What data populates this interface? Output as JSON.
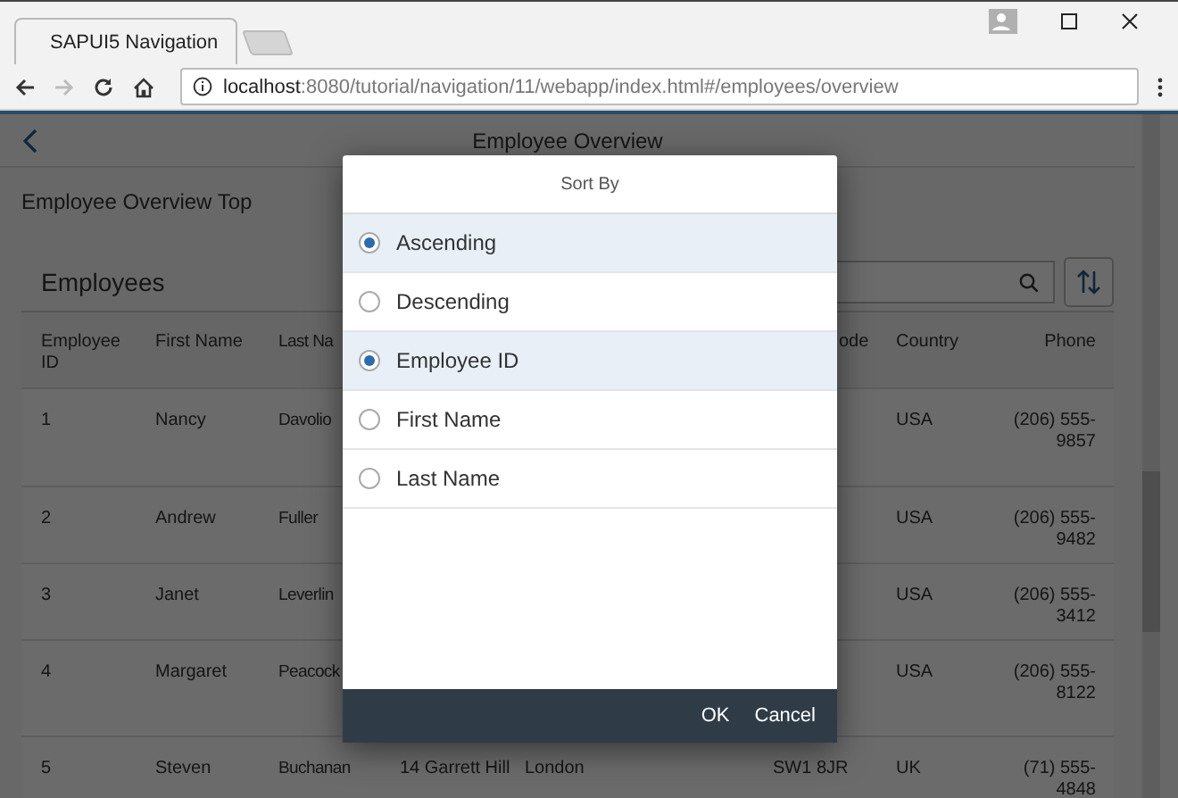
{
  "browser": {
    "tab_title": "SAPUI5 Navigation",
    "url_host": "localhost",
    "url_rest": ":8080/tutorial/navigation/11/webapp/index.html#/employees/overview"
  },
  "page": {
    "title": "Employee Overview",
    "section_title": "Employee Overview Top"
  },
  "table": {
    "title": "Employees",
    "header": {
      "employee_id": "Employee ID",
      "first_name": "First Name",
      "last_name": "Last Na",
      "postal_code": "ode",
      "country": "Country",
      "phone": "Phone"
    },
    "rows": [
      {
        "employee_id": "1",
        "first_name": "Nancy",
        "last_name": "Davolio",
        "country": "USA",
        "phone": "(206) 555-9857"
      },
      {
        "employee_id": "2",
        "first_name": "Andrew",
        "last_name": "Fuller",
        "country": "USA",
        "phone": "(206) 555-9482"
      },
      {
        "employee_id": "3",
        "first_name": "Janet",
        "last_name": "Leverlin",
        "country": "USA",
        "phone": "(206) 555-3412"
      },
      {
        "employee_id": "4",
        "first_name": "Margaret",
        "last_name": "Peacock",
        "country": "USA",
        "phone": "(206) 555-8122"
      },
      {
        "employee_id": "5",
        "first_name": "Steven",
        "last_name": "Buchanan",
        "address": "14 Garrett Hill",
        "city": "London",
        "postal_code": "SW1 8JR",
        "country": "UK",
        "phone": "(71) 555-4848"
      }
    ]
  },
  "dialog": {
    "title": "Sort By",
    "order": [
      {
        "label": "Ascending",
        "selected": true
      },
      {
        "label": "Descending",
        "selected": false
      }
    ],
    "fields": [
      {
        "label": "Employee ID",
        "selected": true
      },
      {
        "label": "First Name",
        "selected": false
      },
      {
        "label": "Last Name",
        "selected": false
      }
    ],
    "buttons": [
      "OK",
      "Cancel"
    ]
  }
}
